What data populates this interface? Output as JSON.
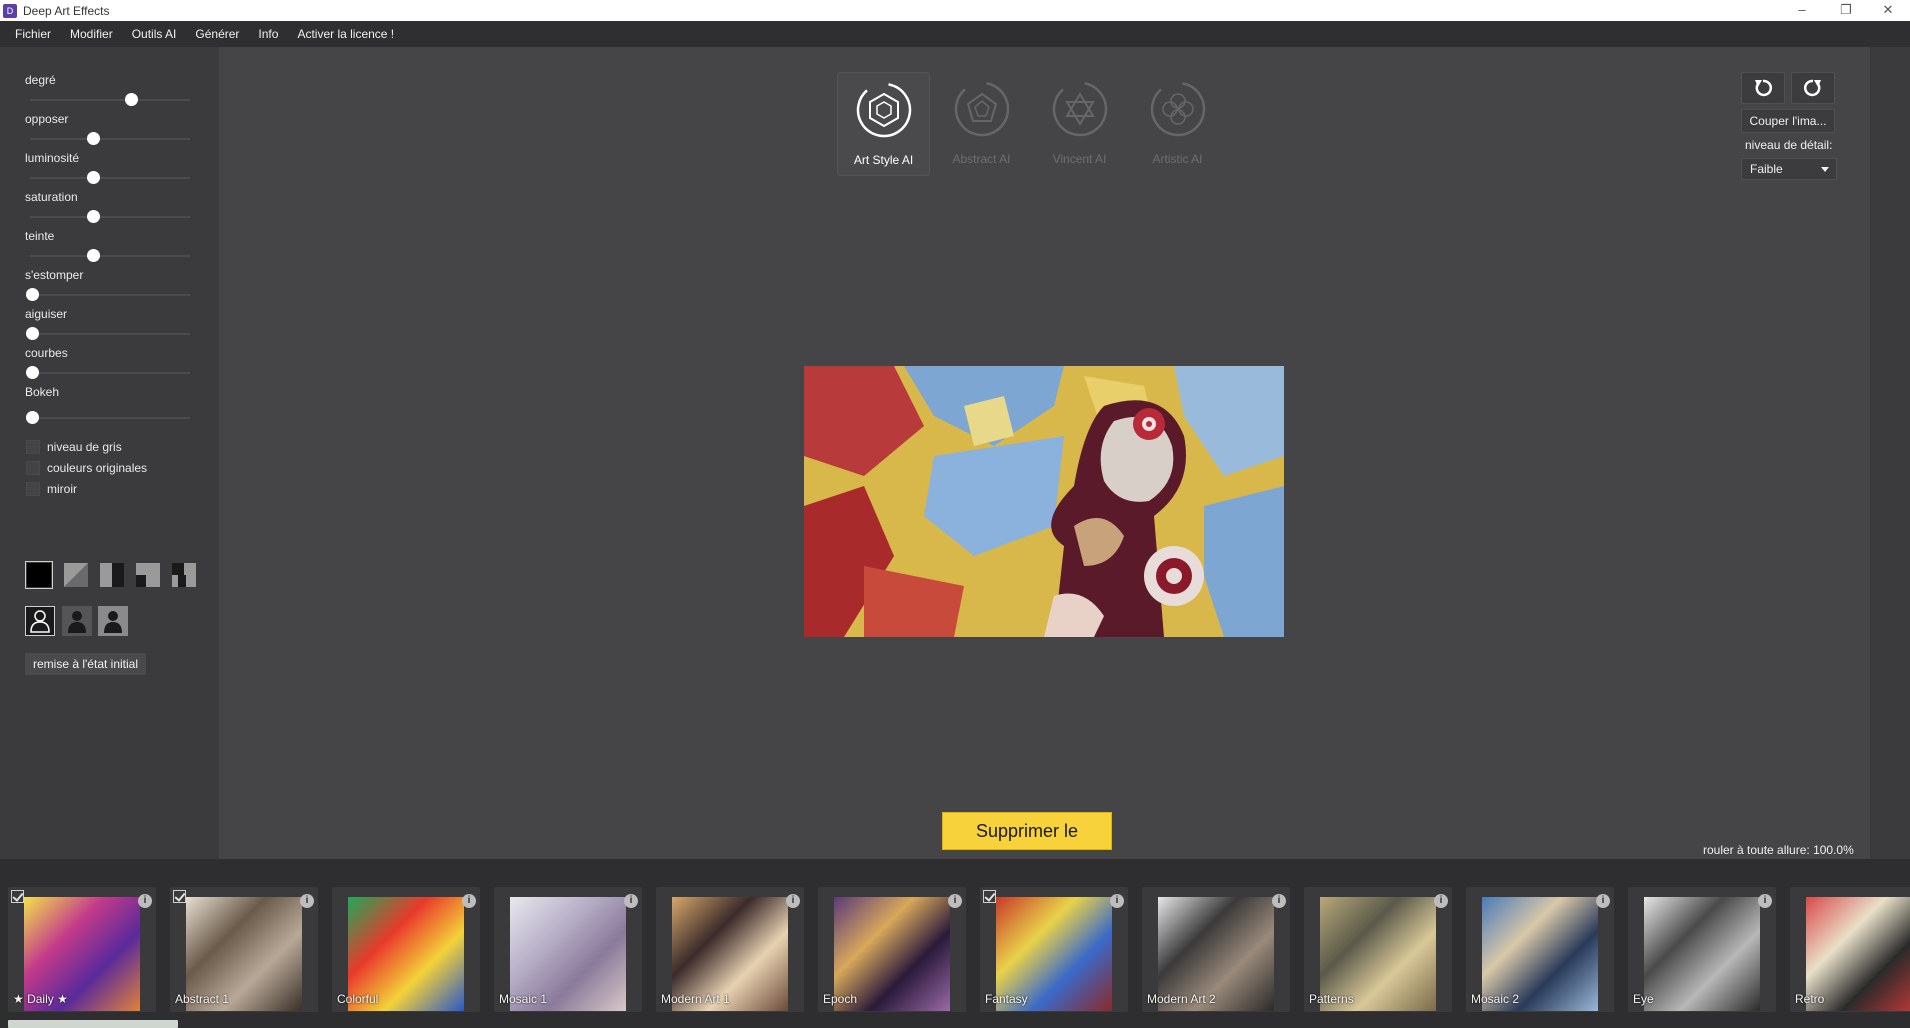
{
  "window": {
    "title": "Deep Art Effects"
  },
  "menu": [
    "Fichier",
    "Modifier",
    "Outils AI",
    "Générer",
    "Info",
    "Activer la licence !"
  ],
  "adjustments": {
    "sliders": [
      {
        "label": "degré",
        "value": 0.62
      },
      {
        "label": "opposer",
        "value": 0.38
      },
      {
        "label": "luminosité",
        "value": 0.38
      },
      {
        "label": "saturation",
        "value": 0.38
      },
      {
        "label": "teinte",
        "value": 0.38
      },
      {
        "label": "s'estomper",
        "value": 0.0
      },
      {
        "label": "aiguiser",
        "value": 0.0
      },
      {
        "label": "courbes",
        "value": 0.0
      },
      {
        "label": "Bokeh",
        "value": 0.0
      }
    ],
    "checkboxes": [
      {
        "label": "niveau de gris",
        "checked": false
      },
      {
        "label": "couleurs originales",
        "checked": false
      },
      {
        "label": "miroir",
        "checked": false
      }
    ],
    "mask_icons": [
      "mask-full-icon",
      "mask-diagonal-icon",
      "mask-split-icon",
      "mask-corner-icon",
      "mask-checker-icon"
    ],
    "person_icons": [
      "person-outline-icon",
      "person-foreground-icon",
      "person-background-icon"
    ],
    "reset_label": "remise à l'état initial"
  },
  "ai_tabs": [
    {
      "label": "Art Style AI",
      "active": true
    },
    {
      "label": "Abstract AI",
      "active": false
    },
    {
      "label": "Vincent AI",
      "active": false
    },
    {
      "label": "Artistic AI",
      "active": false
    }
  ],
  "tools": {
    "rotate_left_icon": "rotate-left-icon",
    "rotate_right_icon": "rotate-right-icon",
    "crop_label": "Couper l'ima...",
    "detail_label": "niveau de détail:",
    "detail_value": "Faible"
  },
  "watermark_button": "Supprimer le filigrane",
  "zoom_status": "rouler à toute allure: 100.0%",
  "styles": [
    {
      "name": "★ Daily ★",
      "checked": true,
      "colors": [
        "#f2e24a",
        "#c23a8a",
        "#5a2a9a",
        "#e0823a"
      ]
    },
    {
      "name": "Abstract 1",
      "checked": true,
      "colors": [
        "#e8e0d2",
        "#6a5a4a",
        "#b8a898",
        "#3a3028"
      ]
    },
    {
      "name": "Colorful",
      "checked": false,
      "colors": [
        "#1fa85a",
        "#e83a2a",
        "#f2d23a",
        "#2a58c8"
      ]
    },
    {
      "name": "Mosaic 1",
      "checked": false,
      "colors": [
        "#e8e8ee",
        "#b8b0c8",
        "#8a7a9a",
        "#d8c8c8"
      ]
    },
    {
      "name": "Modern Art 1",
      "checked": false,
      "colors": [
        "#d8a86a",
        "#3a2a2a",
        "#e8d2b2",
        "#6a4a3a"
      ]
    },
    {
      "name": "Epoch",
      "checked": false,
      "colors": [
        "#5a3a7a",
        "#d8a85a",
        "#2a1a3a",
        "#9a6aa8"
      ]
    },
    {
      "name": "Fantasy",
      "checked": true,
      "colors": [
        "#c83a2a",
        "#e8d24a",
        "#3a6ac8",
        "#8a2a2a"
      ]
    },
    {
      "name": "Modern Art 2",
      "checked": false,
      "colors": [
        "#e8e8e8",
        "#3a3a3a",
        "#9a8a7a",
        "#2a2a2a"
      ]
    },
    {
      "name": "Patterns",
      "checked": false,
      "colors": [
        "#b8a87a",
        "#5a5a4a",
        "#d8c898",
        "#7a6a4a"
      ]
    },
    {
      "name": "Mosaic 2",
      "checked": false,
      "colors": [
        "#4a7ab8",
        "#d8c8a8",
        "#2a3a5a",
        "#9ab8d8"
      ]
    },
    {
      "name": "Eye",
      "checked": false,
      "colors": [
        "#e8e8e8",
        "#4a4a4a",
        "#b8b8b8",
        "#2a2a2a"
      ]
    },
    {
      "name": "Retro",
      "checked": false,
      "colors": [
        "#d84a4a",
        "#e8e0c8",
        "#2a2a2a",
        "#c83a3a"
      ]
    }
  ]
}
